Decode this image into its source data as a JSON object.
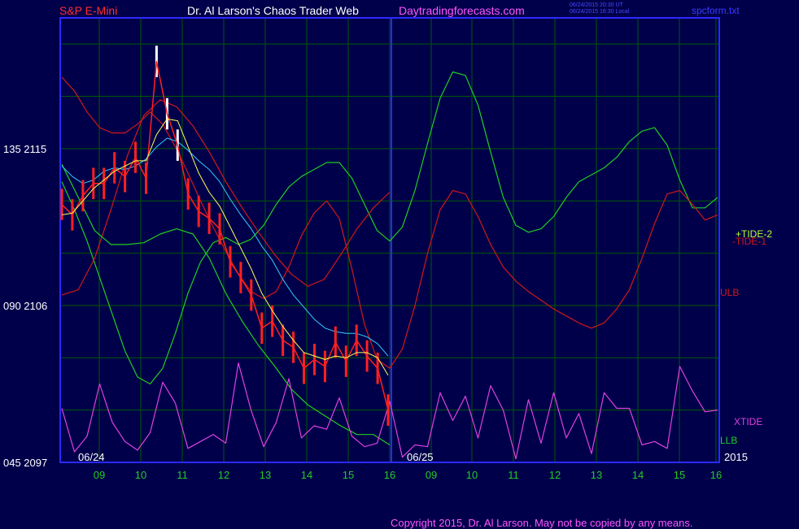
{
  "header": {
    "market": "S&P E-Mini",
    "title": "Dr. Al Larson's Chaos Trader Web",
    "site": "Daytradingforecasts.com",
    "ts_line1": "06/24/2015 20:30 UT",
    "ts_line2": "06/24/2015 16:30 Local",
    "file": "spcform.txt"
  },
  "footer": {
    "copyright": "Copyright 2015, Dr. Al Larson. May not be copied by any means."
  },
  "colors": {
    "background": "#00004a",
    "grid": "#005a00",
    "frame": "#2a2aff",
    "price": "#ff2020",
    "tide1": "#d01818",
    "tide2": "#22cc22",
    "xtide": "#e040e0",
    "avg_fast": "#ffff55",
    "avg_slow": "#33ccff"
  },
  "chart_data": {
    "type": "line",
    "title": "S&P E-Mini",
    "y_axis": {
      "ticks": [
        {
          "label": "135  2115",
          "value": 2115
        },
        {
          "label": "090  2106",
          "value": 2106
        },
        {
          "label": "045  2097",
          "value": 2097
        }
      ],
      "ylim": [
        2097,
        2122.5
      ]
    },
    "x_axis": {
      "ticks": [
        "09",
        "10",
        "11",
        "12",
        "13",
        "14",
        "15",
        "16",
        "09",
        "10",
        "11",
        "12",
        "13",
        "14",
        "15",
        "16"
      ],
      "date_labels": [
        "06/24",
        "06/25",
        "2015"
      ],
      "session_divider_after_tick": 7
    },
    "series": [
      {
        "name": "+TIDE-2",
        "color": "#22cc22",
        "y": [
          2113.1,
          2111.5,
          2109.7,
          2107.6,
          2105.5,
          2103.4,
          2101.9,
          2101.5,
          2102.4,
          2104.4,
          2106.7,
          2108.5,
          2109.6,
          2109.9,
          2109.5,
          2109.8,
          2110.6,
          2111.8,
          2112.8,
          2113.4,
          2113.8,
          2114.2,
          2114.2,
          2113.3,
          2111.8,
          2110.3,
          2109.7,
          2110.5,
          2112.6,
          2115.3,
          2117.9,
          2119.4,
          2119.2,
          2117.5,
          2114.8,
          2112.2,
          2110.6,
          2110.2,
          2110.4,
          2111.1,
          2112.2,
          2113.1,
          2113.5,
          2113.9,
          2114.5,
          2115.4,
          2116.0,
          2116.2,
          2115.2,
          2113.2,
          2111.6,
          2111.6,
          2112.2
        ]
      },
      {
        "name": "-TIDE-1",
        "color": "#d01818",
        "y": [
          2119.1,
          2118.3,
          2117.1,
          2116.2,
          2115.9,
          2115.9,
          2116.4,
          2117.1,
          2116.4,
          2115.1,
          2113.6,
          2112.0,
          2110.5,
          2109.1,
          2107.8,
          2106.8,
          2106.4,
          2106.8,
          2108.2,
          2110.0,
          2111.3,
          2112.0,
          2111.0,
          2108.1,
          2104.9,
          2102.9,
          2102.4,
          2103.5,
          2106.0,
          2109.0,
          2111.5,
          2112.6,
          2112.4,
          2111.1,
          2109.5,
          2108.2,
          2107.4,
          2106.8,
          2106.3,
          2105.8,
          2105.4,
          2105.0,
          2104.7,
          2105.0,
          2105.8,
          2106.9,
          2108.7,
          2110.7,
          2112.4,
          2112.6,
          2111.8,
          2110.9,
          2111.2
        ]
      },
      {
        "name": "ULB",
        "color": "#d01818",
        "y": [
          2106.6,
          2106.9,
          2108.7,
          2111.5,
          2114.6,
          2116.9,
          2117.8,
          2117.4,
          2116.3,
          2114.8,
          2113.1,
          2111.6,
          2110.2,
          2108.9,
          2107.8,
          2107.1,
          2107.5,
          2108.9,
          2110.4,
          2111.6,
          2112.5
        ]
      },
      {
        "name": "LLB",
        "color": "#22cc22",
        "y": [
          2114.1,
          2112.2,
          2110.3,
          2109.5,
          2109.5,
          2109.6,
          2110.1,
          2110.4,
          2110.1,
          2108.7,
          2106.7,
          2105.1,
          2103.7,
          2102.5,
          2101.2,
          2100.3,
          2099.7,
          2099.1,
          2098.6,
          2098.6,
          2098.0
        ]
      },
      {
        "name": "XTIDE",
        "color": "#e040e0",
        "y": [
          2100.1,
          2097.6,
          2098.5,
          2101.5,
          2099.3,
          2098.2,
          2097.7,
          2098.7,
          2101.6,
          2100.4,
          2097.8,
          2098.2,
          2098.6,
          2098.1,
          2102.7,
          2100.0,
          2097.9,
          2099.3,
          2101.8,
          2098.4,
          2099.1,
          2098.9,
          2100.7,
          2098.5,
          2097.9,
          2098.1,
          2100.5,
          2097.3,
          2098.0,
          2097.9,
          2101.0,
          2099.4,
          2100.8,
          2098.4,
          2101.4,
          2100.0,
          2097.2,
          2100.6,
          2098.1,
          2101.0,
          2098.4,
          2099.8,
          2097.5,
          2101.0,
          2100.1,
          2100.1,
          2098.0,
          2098.2,
          2097.8,
          2102.5,
          2101.1,
          2099.9,
          2100.0
        ]
      },
      {
        "name": "",
        "color": "#ff2020",
        "y": [
          2111.8,
          2111.2,
          2112.3,
          2113.0,
          2113.0,
          2113.9,
          2113.4,
          2114.5,
          2113.3,
          2120.0,
          2117.0,
          2115.2,
          2112.4,
          2111.4,
          2111.0,
          2110.4,
          2108.5,
          2107.6,
          2106.6,
          2104.7,
          2105.1,
          2104.0,
          2103.6,
          2102.4,
          2102.9,
          2102.5,
          2103.9,
          2102.8,
          2104.0,
          2103.1,
          2102.4,
          2100.0
        ]
      },
      {
        "name": "",
        "color": "#ffff55",
        "y": [
          2111.2,
          2111.3,
          2112.0,
          2112.7,
          2113.2,
          2113.7,
          2114.0,
          2114.3,
          2114.3,
          2115.8,
          2116.7,
          2116.6,
          2115.1,
          2113.6,
          2112.5,
          2111.7,
          2110.5,
          2109.3,
          2108.1,
          2106.7,
          2105.7,
          2104.8,
          2104.0,
          2103.3,
          2103.1,
          2102.9,
          2103.1,
          2103.0,
          2103.3,
          2103.3,
          2103.0,
          2102.0
        ]
      },
      {
        "name": "",
        "color": "#33ccff",
        "y": [
          2114.0,
          2113.4,
          2113.0,
          2113.2,
          2113.7,
          2113.9,
          2113.8,
          2114.0,
          2114.4,
          2115.1,
          2115.6,
          2115.4,
          2114.9,
          2114.3,
          2113.8,
          2113.1,
          2112.1,
          2111.2,
          2110.4,
          2109.4,
          2108.6,
          2107.5,
          2106.6,
          2105.9,
          2105.2,
          2104.7,
          2104.5,
          2104.4,
          2104.4,
          2104.2,
          2103.8,
          2103.1
        ]
      }
    ]
  }
}
